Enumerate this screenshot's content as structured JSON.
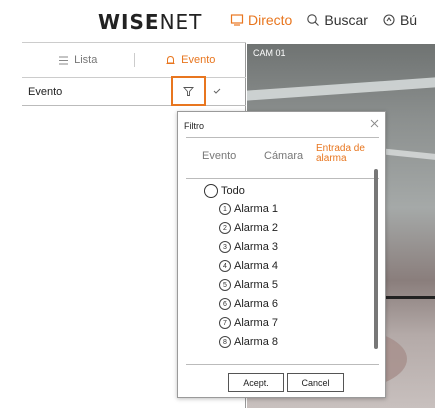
{
  "header": {
    "logo_bold": "WISE",
    "logo_thin": "NET",
    "nav": [
      {
        "label": "Directo",
        "icon": "monitor-icon",
        "active": true
      },
      {
        "label": "Buscar",
        "icon": "search-icon",
        "active": false
      },
      {
        "label": "Bú",
        "icon": "backup-icon",
        "active": false
      }
    ]
  },
  "sidebar": {
    "tabs": [
      {
        "label": "Lista",
        "icon": "list-icon",
        "active": false
      },
      {
        "label": "Evento",
        "icon": "bell-icon",
        "active": true
      }
    ],
    "event_row": {
      "label": "Evento"
    }
  },
  "video": {
    "camera_label": "CAM 01"
  },
  "dialog": {
    "title": "Filtro",
    "tabs": [
      {
        "label": "Evento",
        "active": false
      },
      {
        "label": "Cámara",
        "active": false
      },
      {
        "label_line1": "Entrada de",
        "label_line2": "alarma",
        "active": true
      }
    ],
    "all_option": "Todo",
    "options": [
      {
        "num": "1",
        "label": "Alarma 1"
      },
      {
        "num": "2",
        "label": "Alarma 2"
      },
      {
        "num": "3",
        "label": "Alarma 3"
      },
      {
        "num": "4",
        "label": "Alarma 4"
      },
      {
        "num": "5",
        "label": "Alarma 5"
      },
      {
        "num": "6",
        "label": "Alarma 6"
      },
      {
        "num": "7",
        "label": "Alarma 7"
      },
      {
        "num": "8",
        "label": "Alarma 8"
      }
    ],
    "ok_label": "Acept.",
    "cancel_label": "Cancel"
  },
  "colors": {
    "accent": "#e8761f",
    "border": "#bbbbbb"
  }
}
